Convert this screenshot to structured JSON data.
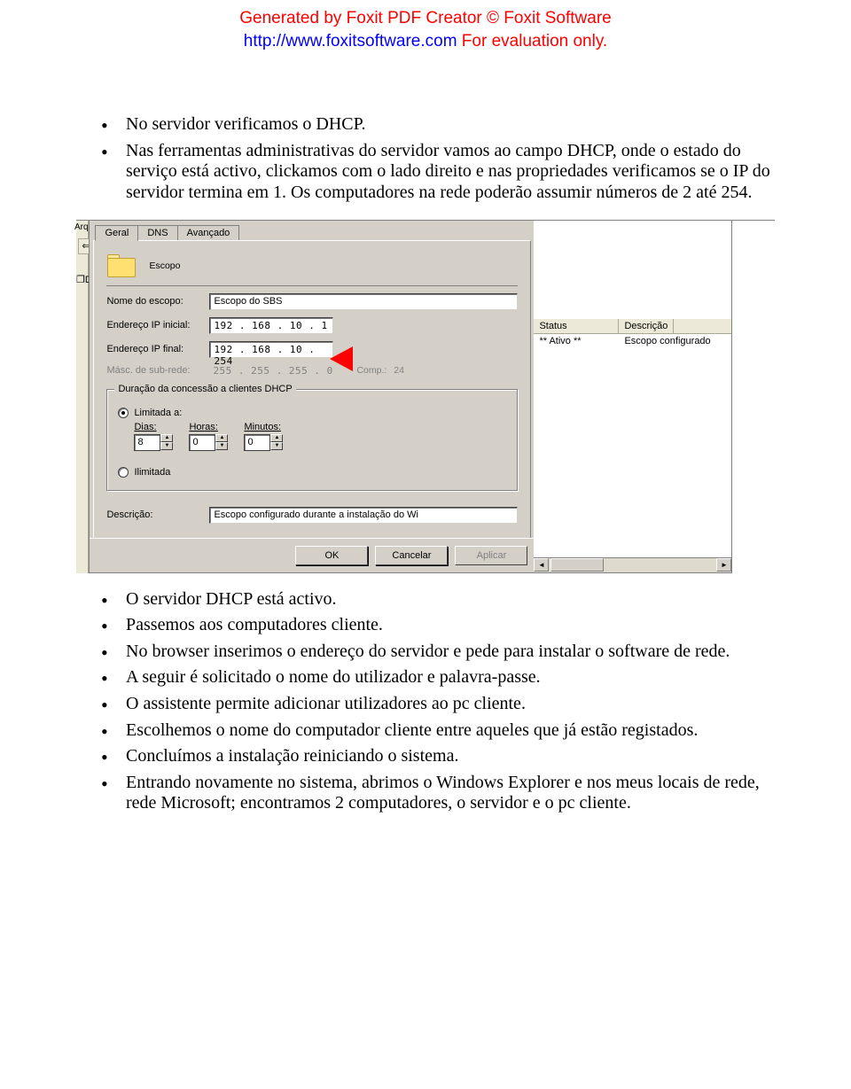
{
  "watermark": {
    "line1": "Generated by Foxit PDF Creator © Foxit Software",
    "link": "http://www.foxitsoftware.com",
    "eval": "   For evaluation only."
  },
  "bullets_top": [
    "No servidor verificamos o DHCP.",
    "Nas ferramentas administrativas do servidor vamos ao campo DHCP, onde o estado do serviço está activo, clickamos com o lado direito e nas propriedades verificamos se o IP do servidor termina em 1. Os computadores na rede poderão assumir números de 2 até 254."
  ],
  "bullets_bottom": [
    "O servidor DHCP está activo.",
    "Passemos aos computadores cliente.",
    "No browser inserimos o endereço do servidor e pede para instalar o software de rede.",
    "A seguir é solicitado o nome do utilizador e palavra-passe.",
    "O assistente permite adicionar utilizadores ao pc cliente.",
    "Escolhemos o nome do computador cliente entre aqueles que já estão registados.",
    "Concluímos a instalação reiniciando o sistema.",
    "Entrando novamente no sistema, abrimos o Windows Explorer e nos meus locais de rede, rede Microsoft; encontramos 2 computadores, o servidor e o pc cliente."
  ],
  "mmc": {
    "arqu": "Arqu",
    "dicon": "D"
  },
  "dialog": {
    "tabs": {
      "geral": "Geral",
      "dns": "DNS",
      "avancado": "Avançado"
    },
    "folder_label": "Escopo",
    "scope_name_label": "Nome do escopo:",
    "scope_name_value": "Escopo do SBS",
    "ip_start_label": "Endereço IP inicial:",
    "ip_start_value": "192 . 168 .  10 .   1",
    "ip_end_label": "Endereço IP final:",
    "ip_end_value": "192 . 168 .  10 . 254",
    "mask_label": "Másc. de sub-rede:",
    "mask_value": "255 . 255 . 255 .   0",
    "comp_label": "Comp.:",
    "comp_value": "24",
    "lease_group": "Duração da concessão a clientes DHCP",
    "radio_limited": "Limitada a:",
    "days_label": "Dias:",
    "days_value": "8",
    "hours_label": "Horas:",
    "hours_value": "0",
    "minutes_label": "Minutos:",
    "minutes_value": "0",
    "radio_unlimited": "Ilimitada",
    "desc_label": "Descrição:",
    "desc_value": "Escopo configurado durante a instalação do Wi",
    "btn_ok": "OK",
    "btn_cancel": "Cancelar",
    "btn_apply": "Aplicar"
  },
  "rightpane": {
    "col_status": "Status",
    "col_desc": "Descrição",
    "row_status": "** Ativo **",
    "row_desc": "Escopo configurado"
  }
}
